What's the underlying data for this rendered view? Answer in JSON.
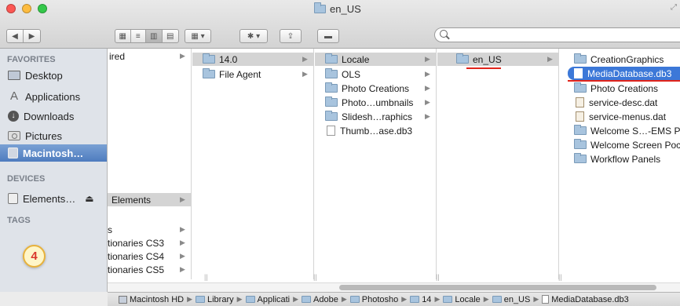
{
  "window": {
    "title": "en_US",
    "search_placeholder": ""
  },
  "toolbar": {
    "back_icon": "chevron-left",
    "forward_icon": "chevron-right",
    "view_icons": [
      "icon-view",
      "list-view",
      "column-view",
      "cover-flow-view"
    ],
    "arrange_icon": "arrange",
    "action_icon": "gear",
    "share_icon": "share",
    "tags_icon": "tag"
  },
  "sidebar": {
    "favorites_header": "FAVORITES",
    "favorites": [
      {
        "label": "Desktop",
        "icon": "desktop"
      },
      {
        "label": "Applications",
        "icon": "applications"
      },
      {
        "label": "Downloads",
        "icon": "downloads"
      },
      {
        "label": "Pictures",
        "icon": "pictures"
      },
      {
        "label": "Macintosh…",
        "icon": "hard-drive",
        "selected": true
      }
    ],
    "devices_header": "DEVICES",
    "devices": [
      {
        "label": "Elements…",
        "icon": "drive",
        "eject": "⏏"
      }
    ],
    "tags_header": "TAGS",
    "annotation_number": "4"
  },
  "columns": {
    "col0": [
      "ired",
      "Elements",
      "s",
      "tionaries CS3",
      "tionaries CS4",
      "tionaries CS5"
    ],
    "col1": [
      "14.0",
      "File Agent"
    ],
    "col2": [
      "Locale",
      "OLS",
      "Photo Creations",
      "Photo…umbnails",
      "Slidesh…raphics",
      "Thumb…ase.db3"
    ],
    "col3": [
      "en_US"
    ],
    "col4": [
      "CreationGraphics",
      "MediaDatabase.db3",
      "Photo Creations",
      "service-desc.dat",
      "service-menus.dat",
      "Welcome S…-EMS P",
      "Welcome Screen Poc",
      "Workflow Panels"
    ]
  },
  "pathbar": [
    {
      "label": "Macintosh HD",
      "icon": "hd"
    },
    {
      "label": "Library",
      "icon": "folder"
    },
    {
      "label": "Applicati",
      "icon": "folder"
    },
    {
      "label": "Adobe",
      "icon": "folder"
    },
    {
      "label": "Photosho",
      "icon": "folder"
    },
    {
      "label": "14",
      "icon": "folder"
    },
    {
      "label": "Locale",
      "icon": "folder"
    },
    {
      "label": "en_US",
      "icon": "folder"
    },
    {
      "label": "MediaDatabase.db3",
      "icon": "document"
    }
  ],
  "colors": {
    "selection": "#3c78d8",
    "sidebar_selection": "#4e7cbf",
    "annotation_underline": "#e0241b",
    "badge_text": "#d9362b"
  }
}
